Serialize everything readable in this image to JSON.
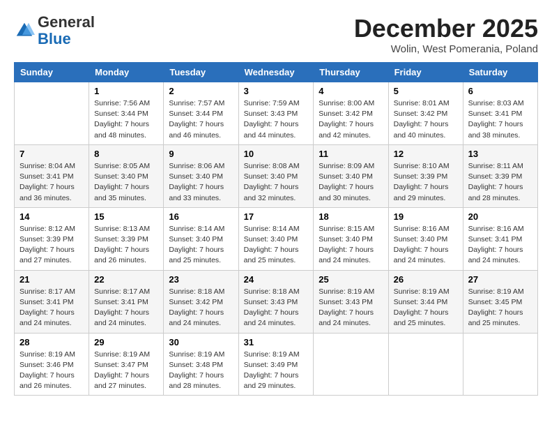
{
  "header": {
    "logo_line1": "General",
    "logo_line2": "Blue",
    "month_title": "December 2025",
    "subtitle": "Wolin, West Pomerania, Poland"
  },
  "days_of_week": [
    "Sunday",
    "Monday",
    "Tuesday",
    "Wednesday",
    "Thursday",
    "Friday",
    "Saturday"
  ],
  "weeks": [
    [
      {
        "day": "",
        "info": ""
      },
      {
        "day": "1",
        "info": "Sunrise: 7:56 AM\nSunset: 3:44 PM\nDaylight: 7 hours\nand 48 minutes."
      },
      {
        "day": "2",
        "info": "Sunrise: 7:57 AM\nSunset: 3:44 PM\nDaylight: 7 hours\nand 46 minutes."
      },
      {
        "day": "3",
        "info": "Sunrise: 7:59 AM\nSunset: 3:43 PM\nDaylight: 7 hours\nand 44 minutes."
      },
      {
        "day": "4",
        "info": "Sunrise: 8:00 AM\nSunset: 3:42 PM\nDaylight: 7 hours\nand 42 minutes."
      },
      {
        "day": "5",
        "info": "Sunrise: 8:01 AM\nSunset: 3:42 PM\nDaylight: 7 hours\nand 40 minutes."
      },
      {
        "day": "6",
        "info": "Sunrise: 8:03 AM\nSunset: 3:41 PM\nDaylight: 7 hours\nand 38 minutes."
      }
    ],
    [
      {
        "day": "7",
        "info": "Sunrise: 8:04 AM\nSunset: 3:41 PM\nDaylight: 7 hours\nand 36 minutes."
      },
      {
        "day": "8",
        "info": "Sunrise: 8:05 AM\nSunset: 3:40 PM\nDaylight: 7 hours\nand 35 minutes."
      },
      {
        "day": "9",
        "info": "Sunrise: 8:06 AM\nSunset: 3:40 PM\nDaylight: 7 hours\nand 33 minutes."
      },
      {
        "day": "10",
        "info": "Sunrise: 8:08 AM\nSunset: 3:40 PM\nDaylight: 7 hours\nand 32 minutes."
      },
      {
        "day": "11",
        "info": "Sunrise: 8:09 AM\nSunset: 3:40 PM\nDaylight: 7 hours\nand 30 minutes."
      },
      {
        "day": "12",
        "info": "Sunrise: 8:10 AM\nSunset: 3:39 PM\nDaylight: 7 hours\nand 29 minutes."
      },
      {
        "day": "13",
        "info": "Sunrise: 8:11 AM\nSunset: 3:39 PM\nDaylight: 7 hours\nand 28 minutes."
      }
    ],
    [
      {
        "day": "14",
        "info": "Sunrise: 8:12 AM\nSunset: 3:39 PM\nDaylight: 7 hours\nand 27 minutes."
      },
      {
        "day": "15",
        "info": "Sunrise: 8:13 AM\nSunset: 3:39 PM\nDaylight: 7 hours\nand 26 minutes."
      },
      {
        "day": "16",
        "info": "Sunrise: 8:14 AM\nSunset: 3:40 PM\nDaylight: 7 hours\nand 25 minutes."
      },
      {
        "day": "17",
        "info": "Sunrise: 8:14 AM\nSunset: 3:40 PM\nDaylight: 7 hours\nand 25 minutes."
      },
      {
        "day": "18",
        "info": "Sunrise: 8:15 AM\nSunset: 3:40 PM\nDaylight: 7 hours\nand 24 minutes."
      },
      {
        "day": "19",
        "info": "Sunrise: 8:16 AM\nSunset: 3:40 PM\nDaylight: 7 hours\nand 24 minutes."
      },
      {
        "day": "20",
        "info": "Sunrise: 8:16 AM\nSunset: 3:41 PM\nDaylight: 7 hours\nand 24 minutes."
      }
    ],
    [
      {
        "day": "21",
        "info": "Sunrise: 8:17 AM\nSunset: 3:41 PM\nDaylight: 7 hours\nand 24 minutes."
      },
      {
        "day": "22",
        "info": "Sunrise: 8:17 AM\nSunset: 3:41 PM\nDaylight: 7 hours\nand 24 minutes."
      },
      {
        "day": "23",
        "info": "Sunrise: 8:18 AM\nSunset: 3:42 PM\nDaylight: 7 hours\nand 24 minutes."
      },
      {
        "day": "24",
        "info": "Sunrise: 8:18 AM\nSunset: 3:43 PM\nDaylight: 7 hours\nand 24 minutes."
      },
      {
        "day": "25",
        "info": "Sunrise: 8:19 AM\nSunset: 3:43 PM\nDaylight: 7 hours\nand 24 minutes."
      },
      {
        "day": "26",
        "info": "Sunrise: 8:19 AM\nSunset: 3:44 PM\nDaylight: 7 hours\nand 25 minutes."
      },
      {
        "day": "27",
        "info": "Sunrise: 8:19 AM\nSunset: 3:45 PM\nDaylight: 7 hours\nand 25 minutes."
      }
    ],
    [
      {
        "day": "28",
        "info": "Sunrise: 8:19 AM\nSunset: 3:46 PM\nDaylight: 7 hours\nand 26 minutes."
      },
      {
        "day": "29",
        "info": "Sunrise: 8:19 AM\nSunset: 3:47 PM\nDaylight: 7 hours\nand 27 minutes."
      },
      {
        "day": "30",
        "info": "Sunrise: 8:19 AM\nSunset: 3:48 PM\nDaylight: 7 hours\nand 28 minutes."
      },
      {
        "day": "31",
        "info": "Sunrise: 8:19 AM\nSunset: 3:49 PM\nDaylight: 7 hours\nand 29 minutes."
      },
      {
        "day": "",
        "info": ""
      },
      {
        "day": "",
        "info": ""
      },
      {
        "day": "",
        "info": ""
      }
    ]
  ]
}
